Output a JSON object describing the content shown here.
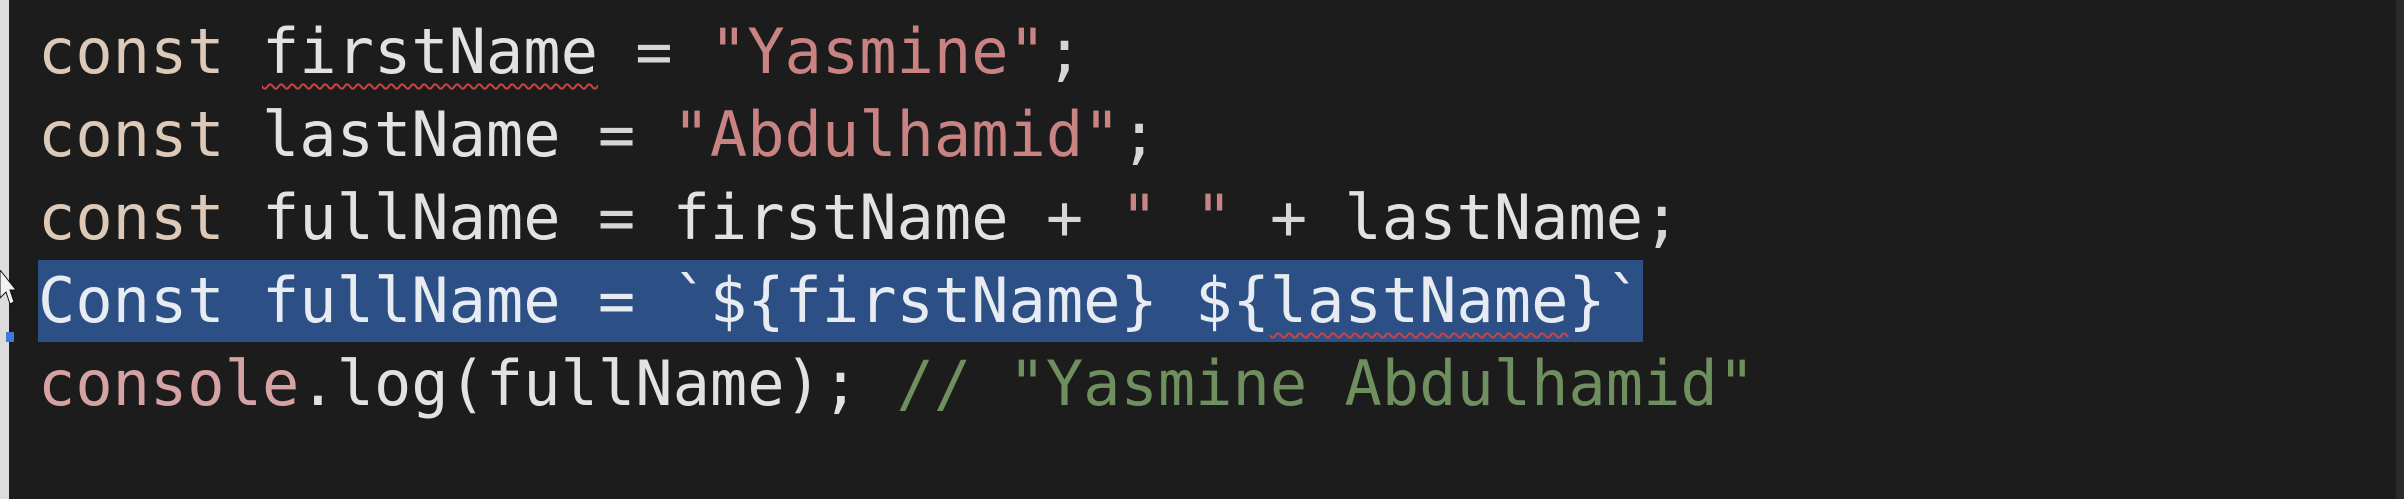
{
  "editor": {
    "line1": {
      "keyword": "const",
      "identifier": "firstName",
      "operator": "=",
      "string": "\"Yasmine\"",
      "end": ";"
    },
    "line2": {
      "keyword": "const",
      "identifier": "lastName",
      "operator": "=",
      "string": "\"Abdulhamid\"",
      "end": ";"
    },
    "line3": {
      "keyword": "const",
      "identifier": "fullName",
      "operator": "=",
      "left": "firstName",
      "plus1": "+",
      "space_string": "\" \"",
      "plus2": "+",
      "right": "lastName",
      "end": ";"
    },
    "line4": {
      "selected_text_start": "Const fullName = `${firstName} ${",
      "selected_text_squiggle": "lastName",
      "selected_text_end": "}`"
    },
    "line5": {
      "object": "console",
      "method": ".log(fullName);",
      "comment": "// \"Yasmine Abdulhamid\""
    }
  },
  "colors": {
    "background": "#1c1c1c",
    "keyword": "#dcc9b7",
    "string": "#c98383",
    "comment": "#6f8f5f",
    "selection": "#2c4f86",
    "spellcheck": "#c94444"
  }
}
